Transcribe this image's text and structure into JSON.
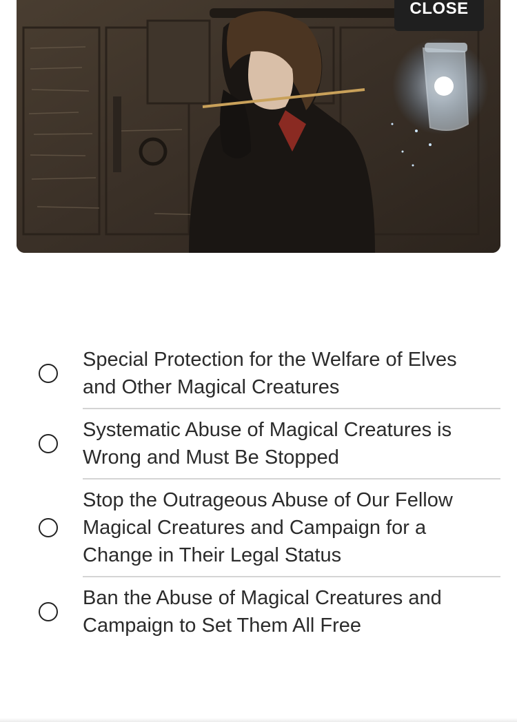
{
  "hero": {
    "image_icon": "illustration-girl-with-wand-and-glowing-jar"
  },
  "close_button": {
    "label": "CLOSE"
  },
  "options": [
    {
      "label": "Special Protection for the Welfare of Elves and Other Magical Creatures",
      "selected": false
    },
    {
      "label": "Systematic Abuse of Magical Creatures is Wrong and Must Be Stopped",
      "selected": false
    },
    {
      "label": "Stop the Outrageous Abuse of Our Fellow Magical Creatures and Campaign for a Change in Their Legal Status",
      "selected": false
    },
    {
      "label": "Ban the Abuse of Magical Creatures and Campaign to Set Them All Free",
      "selected": false
    }
  ],
  "colors": {
    "close_bg": "#1f1f1f",
    "close_text": "#ffffff",
    "text": "#2b2b2b",
    "divider": "#d4d4d4"
  }
}
